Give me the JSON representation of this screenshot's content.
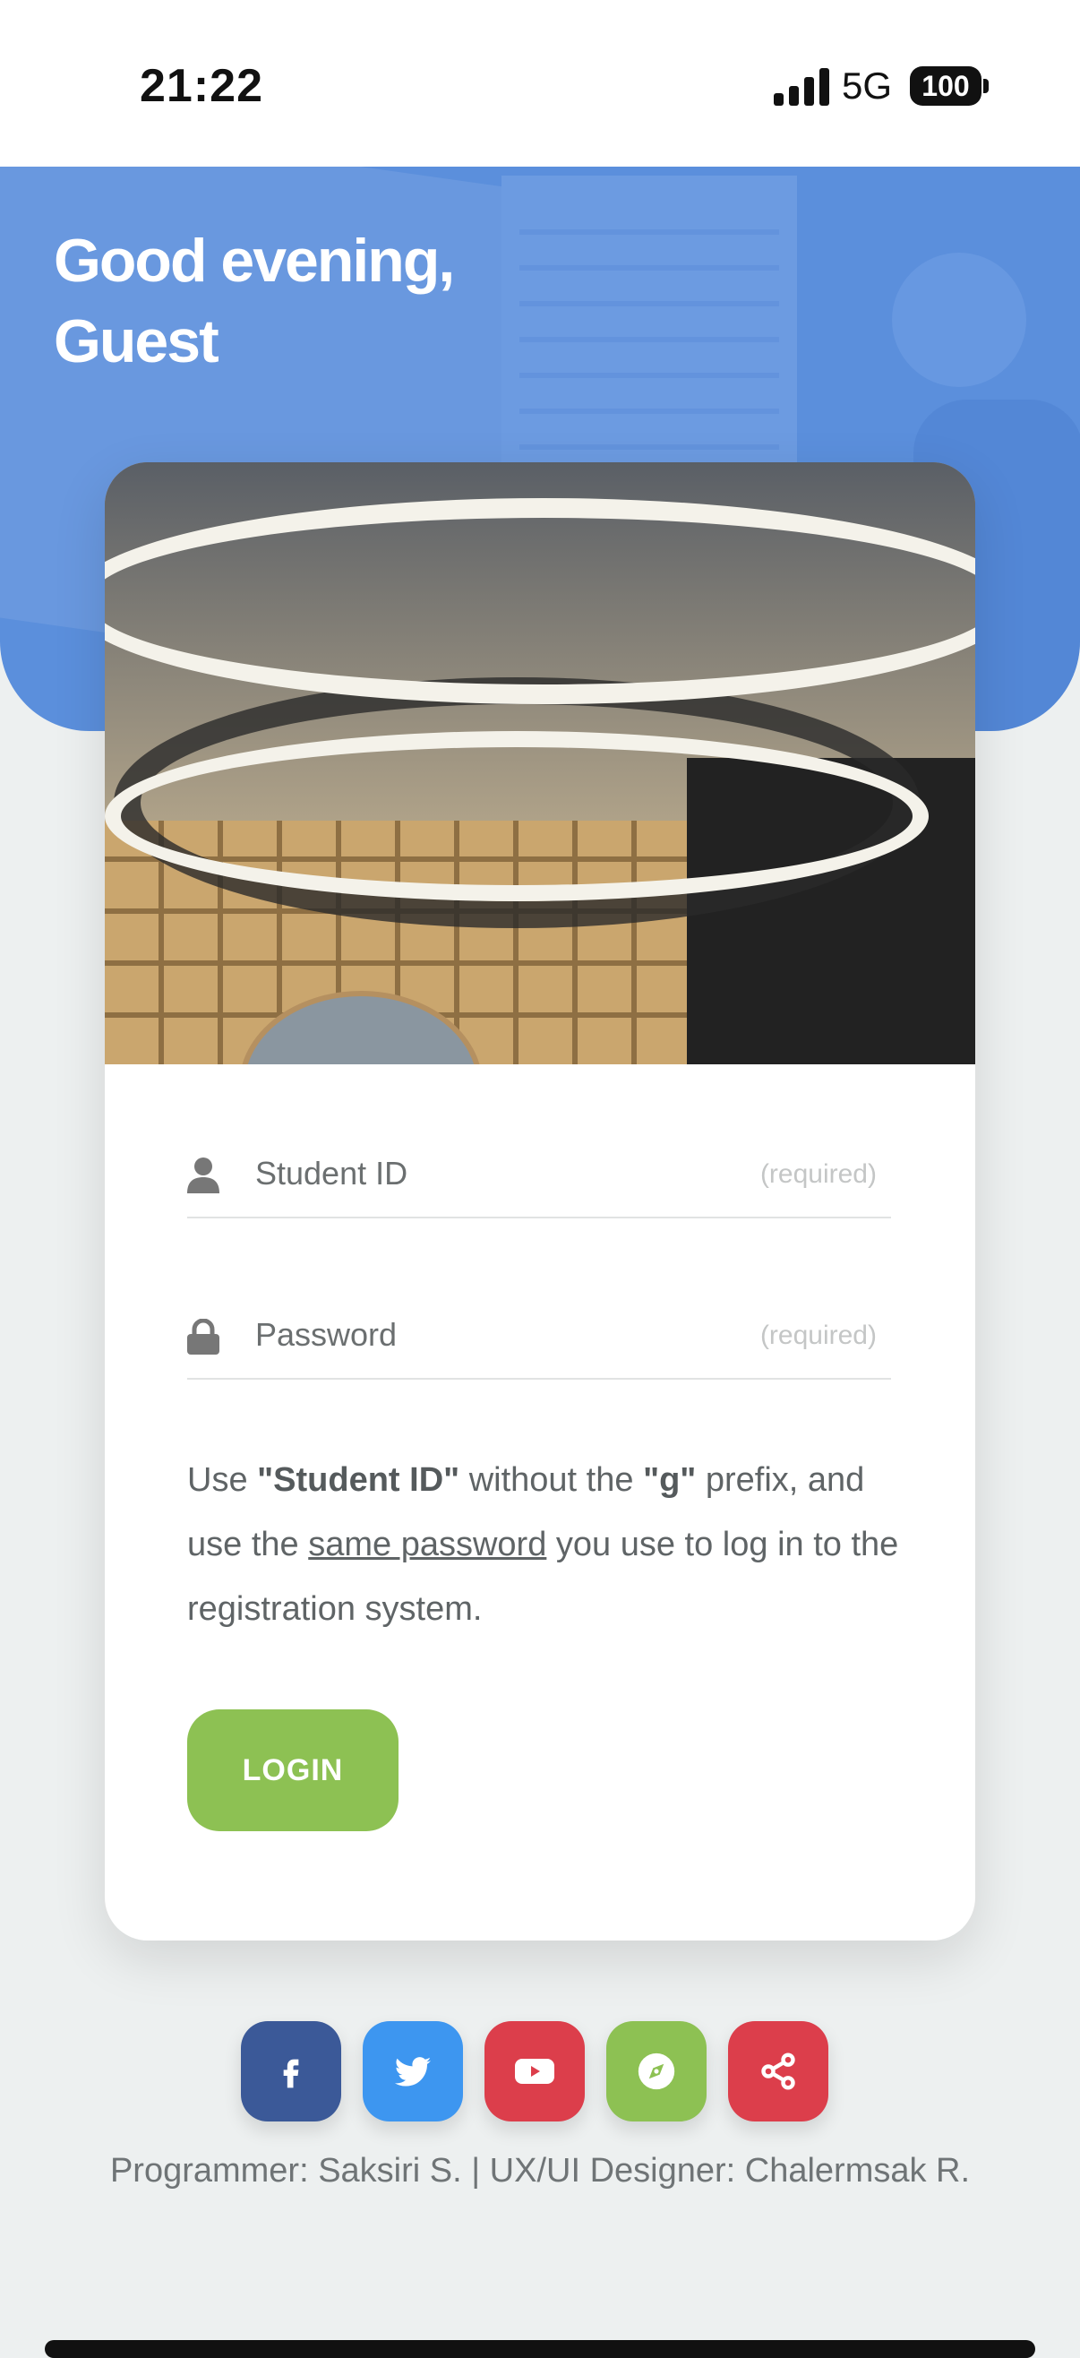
{
  "status_bar": {
    "time": "21:22",
    "network": "5G",
    "battery": "100",
    "icons": [
      "cellular-signal-icon",
      "battery-icon"
    ]
  },
  "hero": {
    "greeting_line1": "Good evening,",
    "greeting_line2": "Guest",
    "background_color": "#5b8fdc"
  },
  "login_form": {
    "student_id": {
      "placeholder": "Student ID",
      "required_label": "(required)",
      "icon": "user-icon"
    },
    "password": {
      "placeholder": "Password",
      "required_label": "(required)",
      "icon": "lock-icon"
    },
    "hint": {
      "t1": "Use ",
      "student_id": "\"Student ID\"",
      "t2": " without the ",
      "prefix": "\"g\"",
      "t3": " prefix, and use the ",
      "same_password": "same password",
      "t4": " you use to log in to the registration system."
    },
    "login_label": "LOGIN",
    "login_color": "#8dc153"
  },
  "social_links": [
    {
      "name": "facebook",
      "icon": "facebook-icon",
      "color": "#3b5998"
    },
    {
      "name": "twitter",
      "icon": "twitter-icon",
      "color": "#3d96f0"
    },
    {
      "name": "youtube",
      "icon": "youtube-icon",
      "color": "#dc3e4b"
    },
    {
      "name": "compass",
      "icon": "compass-icon",
      "color": "#8dc153"
    },
    {
      "name": "share",
      "icon": "share-icon",
      "color": "#dc3e4b"
    }
  ],
  "credits": "Programmer: Saksiri S. | UX/UI Designer: Chalermsak R."
}
